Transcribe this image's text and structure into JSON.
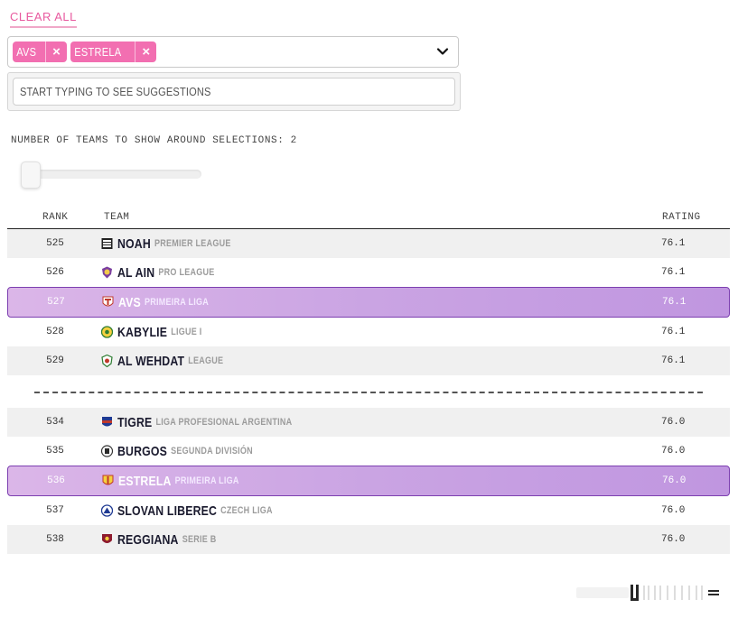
{
  "filters": {
    "clear_all_label": "CLEAR ALL",
    "chips": [
      {
        "label": "AVS",
        "remove_icon": "×"
      },
      {
        "label": "ESTRELA",
        "remove_icon": "×"
      }
    ],
    "dropdown_icon": "chevron-down",
    "search_placeholder": "START TYPING TO SEE SUGGESTIONS"
  },
  "slider": {
    "label": "NUMBER OF TEAMS TO SHOW AROUND SELECTIONS: 2",
    "value": 2
  },
  "table": {
    "headers": {
      "rank": "RANK",
      "team": "TEAM",
      "rating": "RATING"
    },
    "rows": [
      {
        "rank": "525",
        "name": "NOAH",
        "league": "PREMIER LEAGUE",
        "rating": "76.1",
        "highlight": false
      },
      {
        "rank": "526",
        "name": "AL AIN",
        "league": "PRO LEAGUE",
        "rating": "76.1",
        "highlight": false
      },
      {
        "rank": "527",
        "name": "AVS",
        "league": "PRIMEIRA LIGA",
        "rating": "76.1",
        "highlight": true
      },
      {
        "rank": "528",
        "name": "KABYLIE",
        "league": "LIGUE I",
        "rating": "76.1",
        "highlight": false
      },
      {
        "rank": "529",
        "name": "AL WEHDAT",
        "league": "LEAGUE",
        "rating": "76.1",
        "highlight": false
      },
      {
        "rank": "534",
        "name": "TIGRE",
        "league": "LIGA PROFESIONAL ARGENTINA",
        "rating": "76.0",
        "highlight": false
      },
      {
        "rank": "535",
        "name": "BURGOS",
        "league": "SEGUNDA DIVISIÓN",
        "rating": "76.0",
        "highlight": false
      },
      {
        "rank": "536",
        "name": "ESTRELA",
        "league": "PRIMEIRA LIGA",
        "rating": "76.0",
        "highlight": true
      },
      {
        "rank": "537",
        "name": "SLOVAN LIBEREC",
        "league": "CZECH LIGA",
        "rating": "76.0",
        "highlight": false
      },
      {
        "rank": "538",
        "name": "REGGIANA",
        "league": "SERIE B",
        "rating": "76.0",
        "highlight": false
      }
    ]
  },
  "colors": {
    "accent": "#f26fb1",
    "highlight_start": "#dbb6e8",
    "highlight_end": "#c096e0",
    "highlight_border": "#7c3fb0"
  }
}
